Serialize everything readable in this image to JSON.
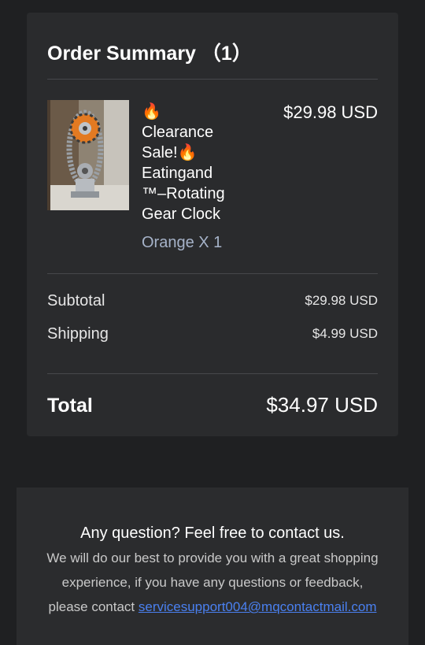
{
  "order_summary": {
    "title": "Order Summary （1）",
    "item": {
      "name": "🔥\nClearance\nSale!🔥\nEatingand\n™–Rotating\nGear Clock",
      "variant": "Orange X 1",
      "price": "$29.98 USD",
      "image_icon": "gear-clock-product-photo"
    },
    "subtotal": {
      "label": "Subtotal",
      "value": "$29.98 USD"
    },
    "shipping": {
      "label": "Shipping",
      "value": "$4.99 USD"
    },
    "total": {
      "label": "Total",
      "value": "$34.97 USD"
    }
  },
  "contact": {
    "heading": "Any question? Feel free to contact us.",
    "line1": "We will do our best to provide you with a great shopping",
    "line2": "experience, if you have any questions or feedback,",
    "line3_prefix": "please contact ",
    "email": "servicesupport004@mqcontactmail.com"
  },
  "colors": {
    "background": "#1f2022",
    "card": "#2a2b2d",
    "variant_text": "#a6b3c9",
    "link": "#4a80f0"
  }
}
